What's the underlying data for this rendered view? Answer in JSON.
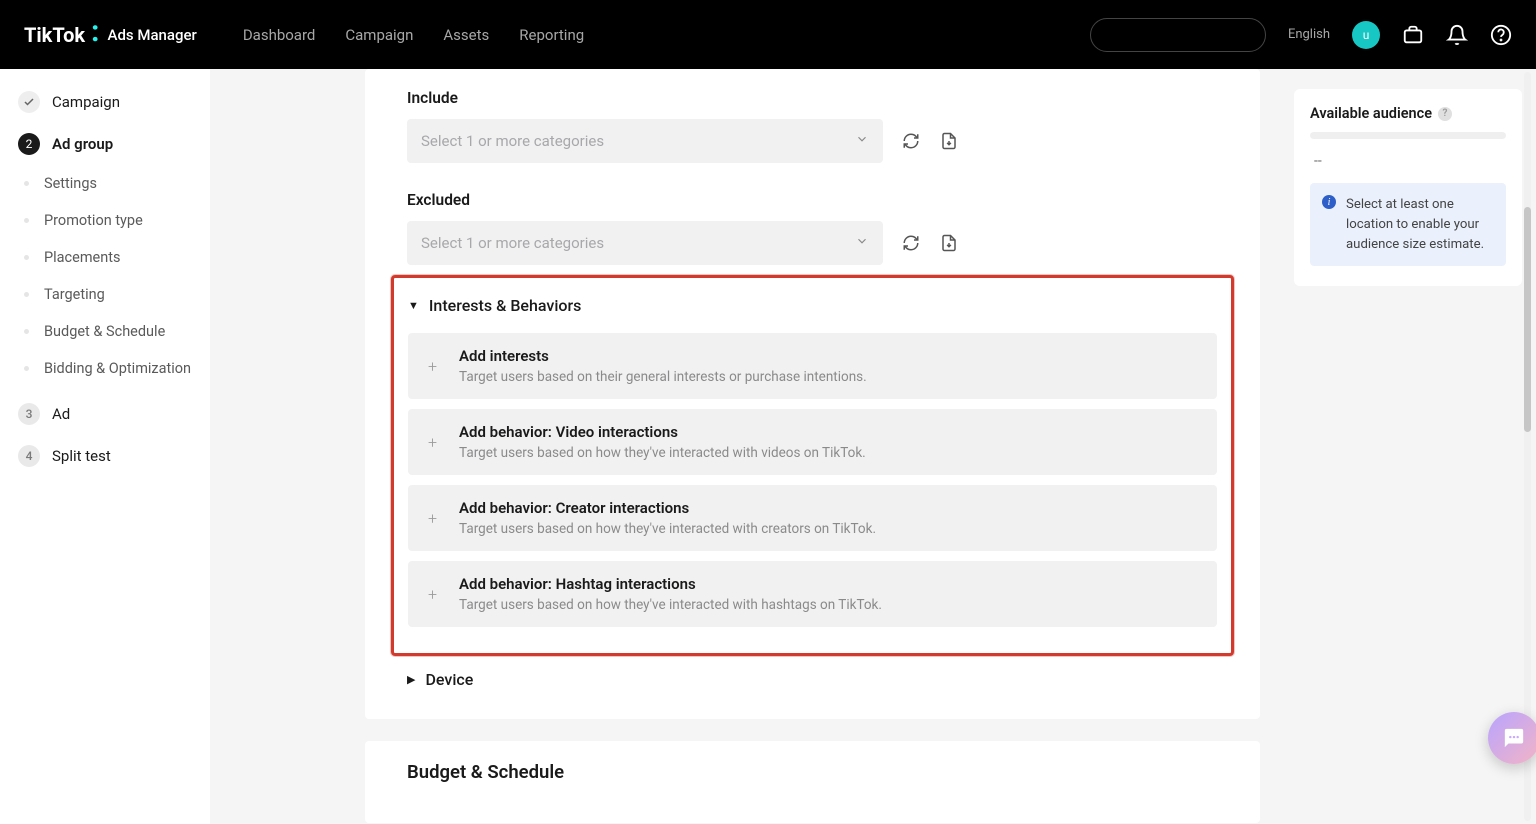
{
  "header": {
    "brand_main": "TikTok",
    "brand_sub": "Ads Manager",
    "nav": [
      "Dashboard",
      "Campaign",
      "Assets",
      "Reporting"
    ],
    "lang": "English",
    "avatar_initial": "u"
  },
  "sidebar": {
    "items": [
      {
        "type": "step",
        "state": "done",
        "label": "Campaign"
      },
      {
        "type": "step",
        "state": "active",
        "label": "Ad group"
      },
      {
        "type": "sub",
        "label": "Settings"
      },
      {
        "type": "sub",
        "label": "Promotion type"
      },
      {
        "type": "sub",
        "label": "Placements"
      },
      {
        "type": "sub",
        "label": "Targeting"
      },
      {
        "type": "sub",
        "label": "Budget & Schedule"
      },
      {
        "type": "sub",
        "label": "Bidding & Optimization"
      },
      {
        "type": "step",
        "state": "num",
        "num": "3",
        "label": "Ad"
      },
      {
        "type": "step",
        "state": "num",
        "num": "4",
        "label": "Split test"
      }
    ]
  },
  "main": {
    "include_label": "Include",
    "excluded_label": "Excluded",
    "select_placeholder": "Select 1 or more categories",
    "interests_section": "Interests & Behaviors",
    "options": [
      {
        "title": "Add interests",
        "desc": "Target users based on their general interests or purchase intentions."
      },
      {
        "title": "Add behavior: Video interactions",
        "desc": "Target users based on how they've interacted with videos on TikTok."
      },
      {
        "title": "Add behavior: Creator interactions",
        "desc": "Target users based on how they've interacted with creators on TikTok."
      },
      {
        "title": "Add behavior: Hashtag interactions",
        "desc": "Target users based on how they've interacted with hashtags on TikTok."
      }
    ],
    "device_section": "Device",
    "budget_heading": "Budget & Schedule"
  },
  "right": {
    "available_title": "Available audience",
    "dash": "--",
    "info_text": "Select at least one location to enable your audience size estimate."
  }
}
